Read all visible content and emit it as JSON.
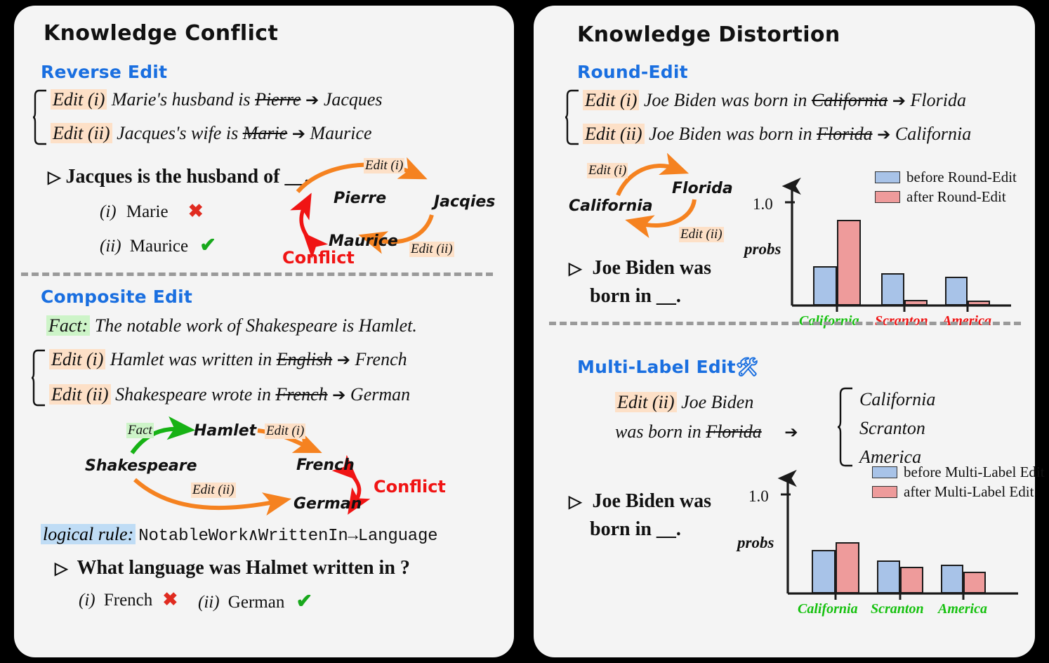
{
  "left_panel": {
    "title": "Knowledge Conflict",
    "section1": {
      "heading": "Reverse Edit",
      "edits": [
        {
          "tag": "Edit (i)",
          "pre": "Marie's husband is",
          "old": "Pierre",
          "arrow": "➔",
          "new": "Jacques"
        },
        {
          "tag": "Edit (ii)",
          "pre": "Jacques's wife is",
          "old": "Marie",
          "arrow": "➔",
          "new": "Maurice"
        }
      ],
      "question": "Jacques is the husband of  __.",
      "bullet": "▷",
      "options": [
        {
          "idx": "(i)",
          "text": "Marie",
          "mark": "✖",
          "correct": false
        },
        {
          "idx": "(ii)",
          "text": "Maurice",
          "mark": "✔",
          "correct": true
        }
      ],
      "graph": {
        "nodes": [
          "Pierre",
          "Jacqies",
          "Maurice"
        ],
        "edge_labels": [
          "Edit (i)",
          "Edit (ii)"
        ],
        "conflict_label": "Conflict"
      }
    },
    "section2": {
      "heading": "Composite Edit",
      "fact": {
        "tag": "Fact:",
        "text": "The notable work of Shakespeare is Hamlet."
      },
      "edits": [
        {
          "tag": "Edit (i)",
          "pre": "Hamlet was written in ",
          "old": "English",
          "arrow": "➔",
          "new": "French"
        },
        {
          "tag": "Edit (ii)",
          "pre": "Shakespeare wrote in",
          "old": "French",
          "arrow": "➔",
          "new": "German"
        }
      ],
      "graph": {
        "nodes": [
          "Shakespeare",
          "Hamlet",
          "French",
          "German"
        ],
        "edge_labels": [
          "Fact",
          "Edit (i)",
          "Edit (ii)"
        ],
        "conflict_label": "Conflict"
      },
      "rule": {
        "tag": "logical rule:",
        "formula": "NotableWork∧WrittenIn→Language"
      },
      "question": "What language was Halmet written in ?",
      "bullet": "▷",
      "options": [
        {
          "idx": "(i)",
          "text": "French",
          "mark": "✖",
          "correct": false
        },
        {
          "idx": "(ii)",
          "text": "German",
          "mark": "✔",
          "correct": true
        }
      ]
    }
  },
  "right_panel": {
    "title": "Knowledge Distortion",
    "section1": {
      "heading": "Round-Edit",
      "edits": [
        {
          "tag": "Edit (i)",
          "pre": "Joe Biden was born in",
          "old": "California",
          "arrow": "➔",
          "new": "Florida"
        },
        {
          "tag": "Edit (ii)",
          "pre": "Joe Biden was born in",
          "old": "Florida",
          "arrow": "➔",
          "new": "California"
        }
      ],
      "graph": {
        "nodes": [
          "California",
          "Florida"
        ],
        "edge_labels": [
          "Edit (i)",
          "Edit (ii)"
        ]
      },
      "bullet": "▷",
      "question_l1": "Joe Biden was",
      "question_l2": "born in __."
    },
    "section2": {
      "heading": "Multi-Label Edit",
      "heading_emoji": "🛠",
      "edit": {
        "tag": "Edit (ii)",
        "l1": "Joe Biden",
        "l2pre": "was born in",
        "old": "Florida",
        "arrow": "➔"
      },
      "targets": [
        "California",
        "Scranton",
        "America"
      ],
      "bullet": "▷",
      "question_l1": "Joe Biden was",
      "question_l2": "born in __."
    }
  },
  "colors": {
    "before_bar": "#a8c3e8",
    "after_bar": "#ee9b9b",
    "bar_border": "#1b1b1b",
    "green_label": "#16c10f",
    "red_label": "#f01414",
    "heading_blue": "#1a6fe0",
    "edit_highlight": "#fde0c7",
    "fact_highlight": "#cdf4c8",
    "rule_highlight": "#bfdcf5",
    "arrow_orange": "#f58220",
    "arrow_green": "#17b215",
    "conflict_red": "#f01414",
    "panel_bg": "#f4f4f4"
  },
  "chart_data": [
    {
      "type": "bar",
      "id": "round-edit-chart",
      "title": "",
      "xlabel": "",
      "ylabel": "probs",
      "ylim": [
        0,
        1.0
      ],
      "ytick_labels": [
        "1.0"
      ],
      "ytick_values": [
        1.0
      ],
      "categories": [
        "California",
        "Scranton",
        "America"
      ],
      "category_colors": [
        "#16c10f",
        "#f01414",
        "#f01414"
      ],
      "legend_position": "top-right",
      "grid": false,
      "series": [
        {
          "name": "before Round-Edit",
          "color": "#a8c3e8",
          "values": [
            0.38,
            0.31,
            0.28
          ]
        },
        {
          "name": "after Round-Edit",
          "color": "#ee9b9b",
          "values": [
            0.83,
            0.055,
            0.045
          ]
        }
      ]
    },
    {
      "type": "bar",
      "id": "multi-label-edit-chart",
      "title": "",
      "xlabel": "",
      "ylabel": "probs",
      "ylim": [
        0,
        1.0
      ],
      "ytick_labels": [
        "1.0"
      ],
      "ytick_values": [
        1.0
      ],
      "categories": [
        "California",
        "Scranton",
        "America"
      ],
      "category_colors": [
        "#16c10f",
        "#16c10f",
        "#16c10f"
      ],
      "legend_position": "top-right",
      "grid": false,
      "series": [
        {
          "name": "before Multi-Label Edit",
          "color": "#a8c3e8",
          "values": [
            0.44,
            0.33,
            0.29
          ]
        },
        {
          "name": "after Multi-Label Edit",
          "color": "#ee9b9b",
          "values": [
            0.52,
            0.27,
            0.22
          ]
        }
      ]
    }
  ]
}
